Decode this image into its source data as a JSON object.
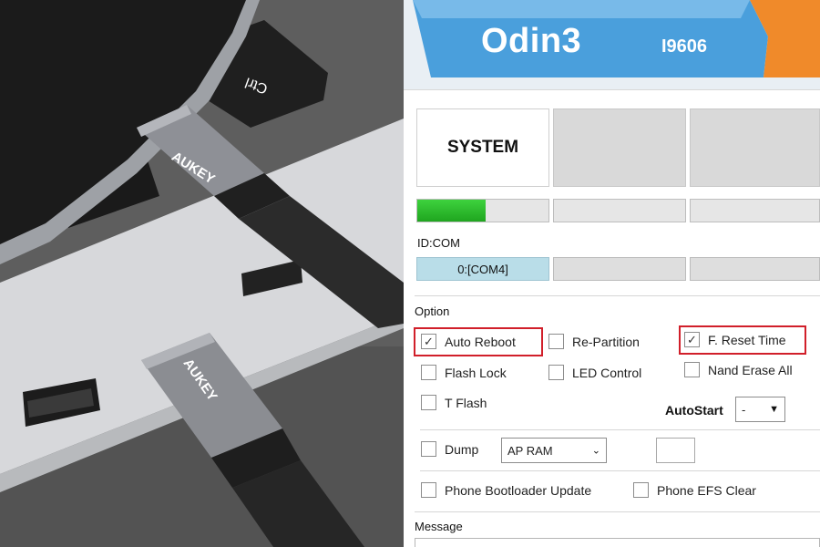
{
  "photo": {
    "cable_brand_top": "AUKEY",
    "cable_brand_bottom": "AUKEY",
    "key_label": "Ctrl"
  },
  "odin": {
    "title": "Odin3",
    "model": "I9606",
    "slots": [
      {
        "label": "SYSTEM",
        "active": true
      },
      {
        "label": "",
        "active": false
      },
      {
        "label": "",
        "active": false
      }
    ],
    "progress": [
      0.5,
      0,
      0
    ],
    "idcom_label": "ID:COM",
    "com_ports": [
      "0:[COM4]",
      "",
      ""
    ],
    "option_label": "Option",
    "options": {
      "auto_reboot": {
        "label": "Auto Reboot",
        "checked": true
      },
      "re_partition": {
        "label": "Re-Partition",
        "checked": false
      },
      "f_reset_time": {
        "label": "F. Reset Time",
        "checked": true
      },
      "flash_lock": {
        "label": "Flash Lock",
        "checked": false
      },
      "led_control": {
        "label": "LED Control",
        "checked": false
      },
      "nand_erase_all": {
        "label": "Nand Erase All",
        "checked": false
      },
      "t_flash": {
        "label": "T Flash",
        "checked": false
      },
      "dump": {
        "label": "Dump",
        "checked": false
      },
      "phone_bootloader_update": {
        "label": "Phone Bootloader Update",
        "checked": false
      },
      "phone_efs_clear": {
        "label": "Phone EFS Clear",
        "checked": false
      }
    },
    "autostart_label": "AutoStart",
    "autostart_value": "-",
    "dump_select_value": "AP RAM",
    "message_label": "Message"
  },
  "colors": {
    "highlight": "#d11f2a",
    "progress_green": "#2ab92a",
    "header_blue": "#4a9fdc",
    "header_orange": "#f08a2a"
  }
}
